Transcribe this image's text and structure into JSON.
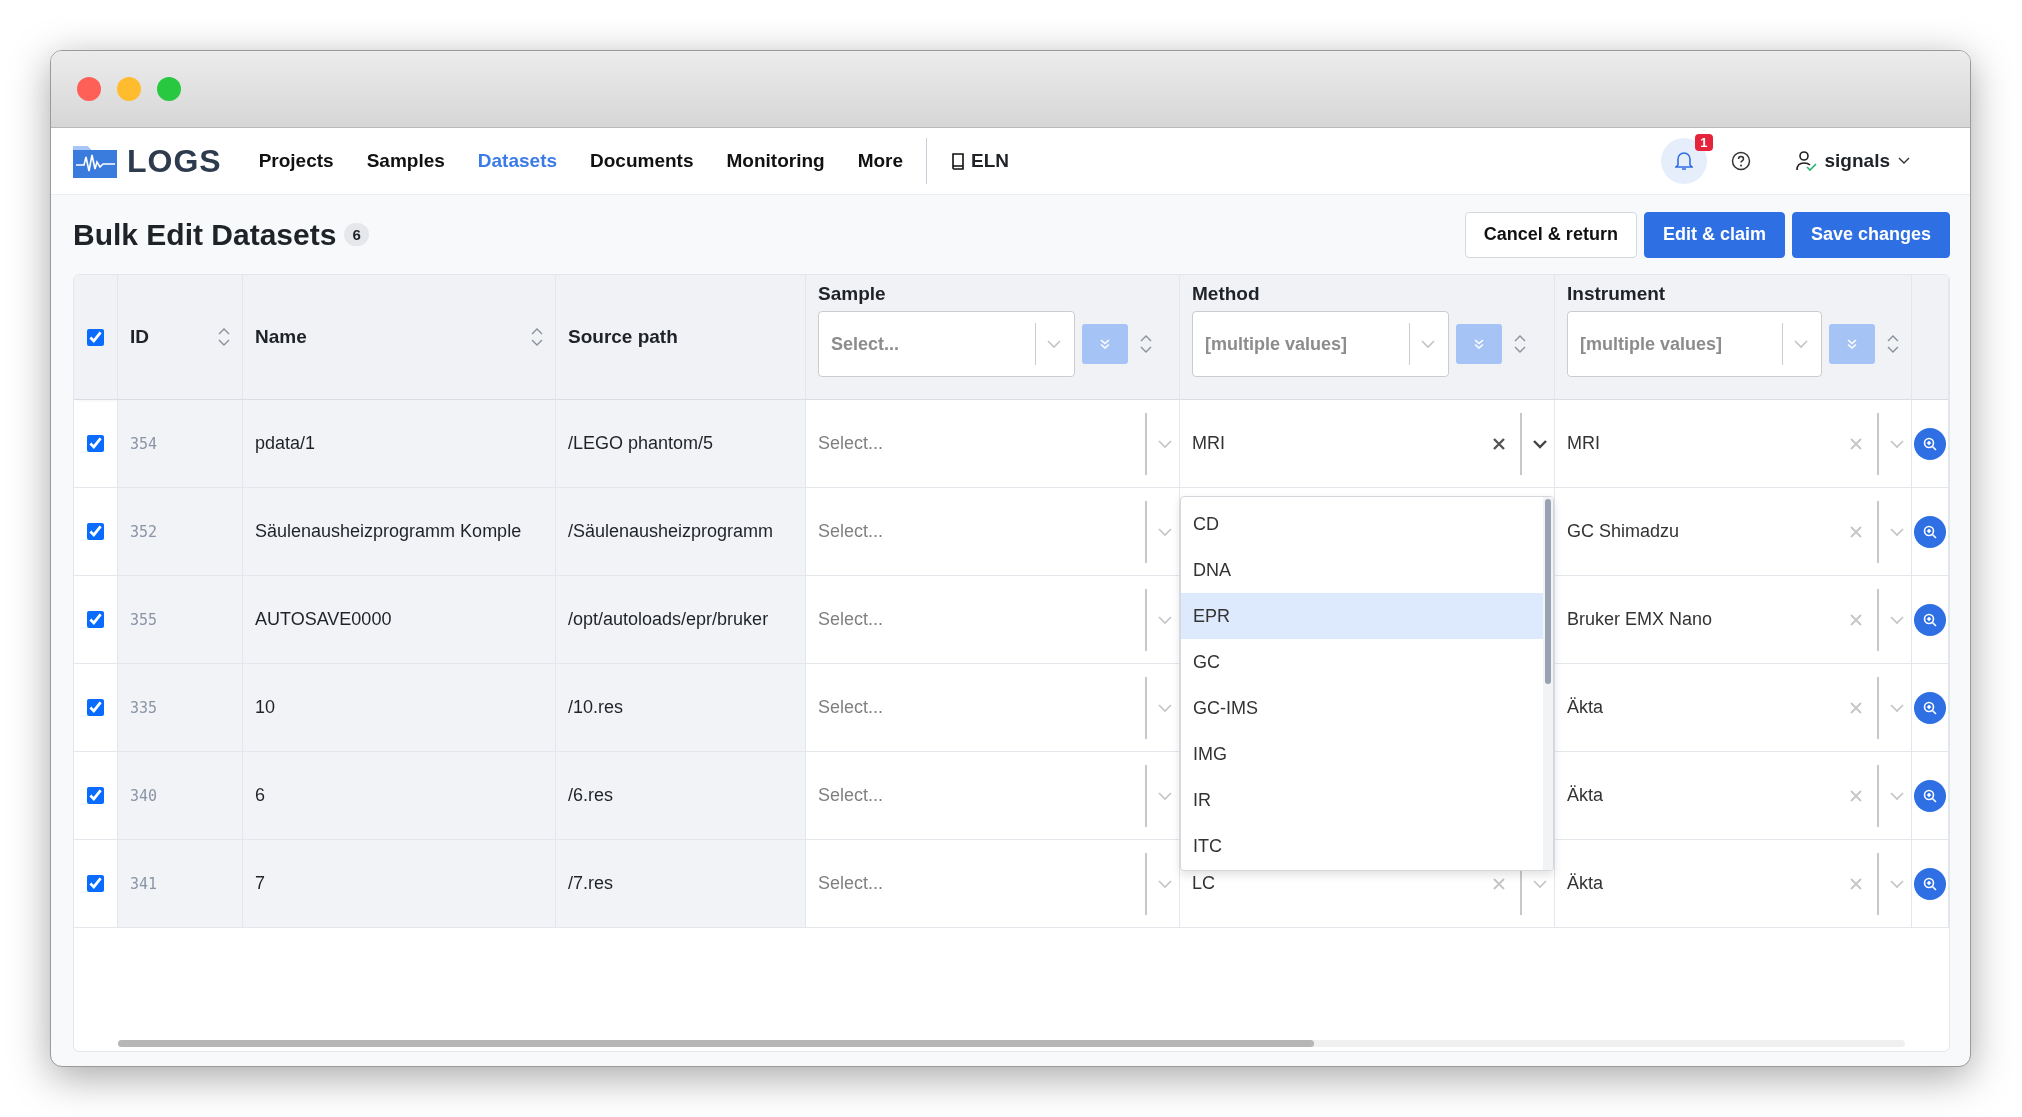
{
  "nav": {
    "logo": "LOGS",
    "items": [
      {
        "label": "Projects",
        "selected": false
      },
      {
        "label": "Samples",
        "selected": false
      },
      {
        "label": "Datasets",
        "selected": true
      },
      {
        "label": "Documents",
        "selected": false
      },
      {
        "label": "Monitoring",
        "selected": false
      },
      {
        "label": "More",
        "selected": false
      }
    ],
    "eln": "ELN",
    "notification_count": "1",
    "user": "signals"
  },
  "page": {
    "title": "Bulk Edit Datasets",
    "count": "6",
    "buttons": [
      {
        "label": "Cancel & return",
        "kind": "secondary"
      },
      {
        "label": "Edit & claim",
        "kind": "primary"
      },
      {
        "label": "Save changes",
        "kind": "primary"
      }
    ]
  },
  "table": {
    "select_all_checked": true,
    "columns": [
      {
        "label": "ID",
        "kind": "sortable"
      },
      {
        "label": "Name",
        "kind": "sortable"
      },
      {
        "label": "Source path",
        "kind": "plain"
      },
      {
        "label": "Sample",
        "kind": "bulk",
        "placeholder": "Select..."
      },
      {
        "label": "Method",
        "kind": "bulk",
        "placeholder": "[multiple values]"
      },
      {
        "label": "Instrument",
        "kind": "bulk",
        "placeholder": "[multiple values]"
      }
    ],
    "rows": [
      {
        "checked": true,
        "id": "354",
        "name": "pdata/1",
        "source_path": "/LEGO phantom/5",
        "sample": {
          "placeholder": "Select..."
        },
        "method": {
          "value": "MRI",
          "focused": true
        },
        "instrument": {
          "value": "MRI",
          "focused": false
        }
      },
      {
        "checked": true,
        "id": "352",
        "name": "Säulenausheizprogramm Komple",
        "source_path": "/Säulenausheizprogramm",
        "sample": {
          "placeholder": "Select..."
        },
        "instrument": {
          "value": "GC Shimadzu",
          "focused": false
        }
      },
      {
        "checked": true,
        "id": "355",
        "name": "AUTOSAVE0000",
        "source_path": "/opt/autoloads/epr/bruker",
        "sample": {
          "placeholder": "Select..."
        },
        "instrument": {
          "value": "Bruker EMX Nano",
          "focused": false
        }
      },
      {
        "checked": true,
        "id": "335",
        "name": "10",
        "source_path": "/10.res",
        "sample": {
          "placeholder": "Select..."
        },
        "instrument": {
          "value": "Äkta",
          "focused": false
        }
      },
      {
        "checked": true,
        "id": "340",
        "name": "6",
        "source_path": "/6.res",
        "sample": {
          "placeholder": "Select..."
        },
        "instrument": {
          "value": "Äkta",
          "focused": false
        }
      },
      {
        "checked": true,
        "id": "341",
        "name": "7",
        "source_path": "/7.res",
        "sample": {
          "placeholder": "Select..."
        },
        "method": {
          "value": "LC",
          "focused": false
        },
        "instrument": {
          "value": "Äkta",
          "focused": false
        }
      }
    ],
    "method_dropdown": {
      "options": [
        {
          "label": "CD",
          "selected": false
        },
        {
          "label": "DNA",
          "selected": false
        },
        {
          "label": "EPR",
          "selected": true
        },
        {
          "label": "GC",
          "selected": false
        },
        {
          "label": "GC-IMS",
          "selected": false
        },
        {
          "label": "IMG",
          "selected": false
        },
        {
          "label": "IR",
          "selected": false
        },
        {
          "label": "ITC",
          "selected": false
        }
      ]
    }
  }
}
